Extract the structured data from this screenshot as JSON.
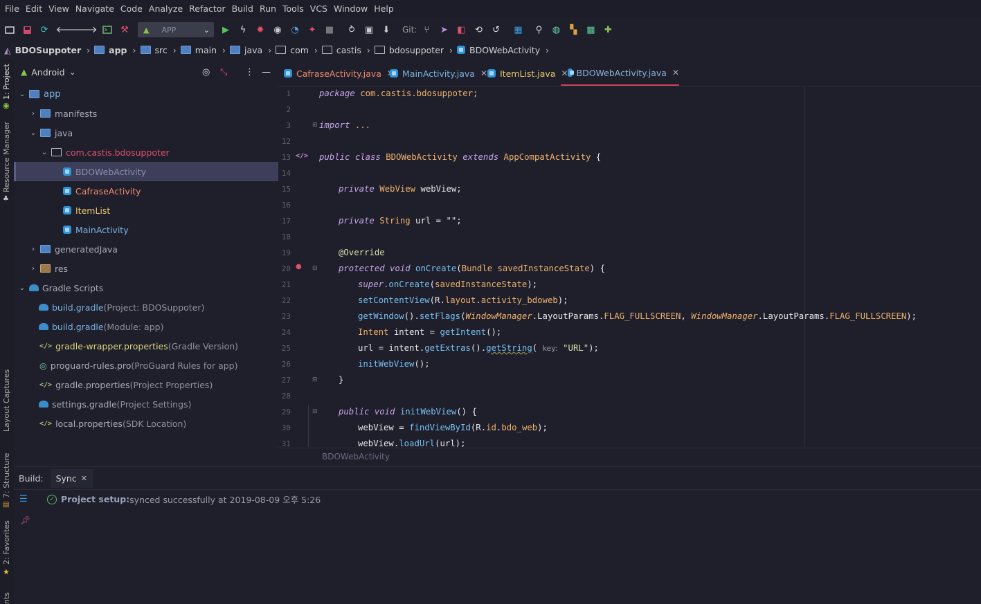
{
  "menu": [
    "File",
    "Edit",
    "View",
    "Navigate",
    "Code",
    "Analyze",
    "Refactor",
    "Build",
    "Run",
    "Tools",
    "VCS",
    "Window",
    "Help"
  ],
  "toolbar": {
    "run_config": "APP",
    "git_label": "Git:"
  },
  "breadcrumb": [
    "BDOSuppoter",
    "app",
    "src",
    "main",
    "java",
    "com",
    "castis",
    "bdosuppoter",
    "BDOWebActivity"
  ],
  "sidebar_left": {
    "project": "1: Project",
    "resource_manager": "Resource Manager",
    "layout_captures": "Layout Captures",
    "structure": "7: Structure",
    "favorites": "2: Favorites",
    "variants": "nts"
  },
  "project": {
    "view": "Android",
    "tree": [
      {
        "label": "app",
        "detail": ""
      },
      {
        "label": "manifests",
        "detail": ""
      },
      {
        "label": "java",
        "detail": ""
      },
      {
        "label": "com.castis.bdosuppoter",
        "detail": ""
      },
      {
        "label": "BDOWebActivity",
        "detail": ""
      },
      {
        "label": "CafraseActivity",
        "detail": ""
      },
      {
        "label": "ItemList",
        "detail": ""
      },
      {
        "label": "MainActivity",
        "detail": ""
      },
      {
        "label": "generatedJava",
        "detail": ""
      },
      {
        "label": "res",
        "detail": ""
      },
      {
        "label": "Gradle Scripts",
        "detail": ""
      },
      {
        "label": "build.gradle",
        "detail": " (Project: BDOSuppoter)"
      },
      {
        "label": "build.gradle",
        "detail": " (Module: app)"
      },
      {
        "label": "gradle-wrapper.properties",
        "detail": " (Gradle Version)"
      },
      {
        "label": "proguard-rules.pro",
        "detail": " (ProGuard Rules for app)"
      },
      {
        "label": "gradle.properties",
        "detail": " (Project Properties)"
      },
      {
        "label": "settings.gradle",
        "detail": " (Project Settings)"
      },
      {
        "label": "local.properties",
        "detail": " (SDK Location)"
      }
    ]
  },
  "tabs": [
    "CafraseActivity.java",
    "MainActivity.java",
    "ItemList.java",
    "BDOWebActivity.java"
  ],
  "line_numbers": [
    "1",
    "2",
    "3",
    "12",
    "13",
    "14",
    "15",
    "16",
    "17",
    "18",
    "19",
    "20",
    "21",
    "22",
    "23",
    "24",
    "25",
    "26",
    "27",
    "28",
    "29",
    "30",
    "31"
  ],
  "code": {
    "l1_kw": "package",
    "l1_rest": " com.castis.bdosuppoter;",
    "l3_kw": "import",
    "l3_rest": " ...",
    "l13_a": "public class",
    "l13_b": " BDOWebActivity ",
    "l13_c": "extends",
    "l13_d": " AppCompatActivity",
    "l13_e": " {",
    "l15_kw": "private",
    "l15_ty": " WebView",
    "l15_rest": " webView;",
    "l17_kw": "private",
    "l17_ty": " String",
    "l17_rest": " url = \"\";",
    "l19": "@Override",
    "l20_kw": "protected void",
    "l20_fn": " onCreate",
    "l20_p": "(",
    "l20_ty": "Bundle",
    "l20_v": " savedInstanceState",
    "l20_e": ") {",
    "l21_kw": "super",
    "l21_fn": ".onCreate",
    "l21_p": "(",
    "l21_v": "savedInstanceState",
    "l21_e": ");",
    "l22_fn": "setContentView",
    "l22_p": "(R.",
    "l22_v": "layout",
    "l22_p2": ".",
    "l22_v2": "activity_bdoweb",
    "l22_e": ");",
    "l23_fn": "getWindow",
    "l23_p": "().",
    "l23_fn2": "setFlags",
    "l23_p2": "(",
    "l23_i1": "WindowManager",
    "l23_p3": ".LayoutParams.",
    "l23_c1": "FLAG_FULLSCREEN",
    "l23_p4": ", ",
    "l23_i2": "WindowManager",
    "l23_p5": ".LayoutParams.",
    "l23_c2": "FLAG_FULLSCREEN",
    "l23_e": ");",
    "l24_ty": "Intent",
    "l24_rest": " intent = ",
    "l24_fn": "getIntent",
    "l24_e": "();",
    "l25_a": "url = intent.",
    "l25_fn": "getExtras",
    "l25_p": "().",
    "l25_fn2": "getString",
    "l25_p2": "( ",
    "l25_hint": "key:",
    "l25_st": " \"URL\"",
    "l25_e": ");",
    "l26_fn": "initWebView",
    "l26_e": "();",
    "l27": "}",
    "l29_kw": "public void",
    "l29_fn": " initWebView",
    "l29_e": "() {",
    "l30_a": "webView = ",
    "l30_fn": "findViewById",
    "l30_p": "(R.",
    "l30_v": "id",
    "l30_p2": ".",
    "l30_v2": "bdo_web",
    "l30_e": ");",
    "l31_a": "webView.",
    "l31_fn": "loadUrl",
    "l31_e": "(url);"
  },
  "editor_footer": "BDOWebActivity",
  "build": {
    "label": "Build:",
    "tab": "Sync",
    "status_bold": "Project setup:",
    "status_text": " synced successfully at 2019-08-09 오후 5:26"
  }
}
